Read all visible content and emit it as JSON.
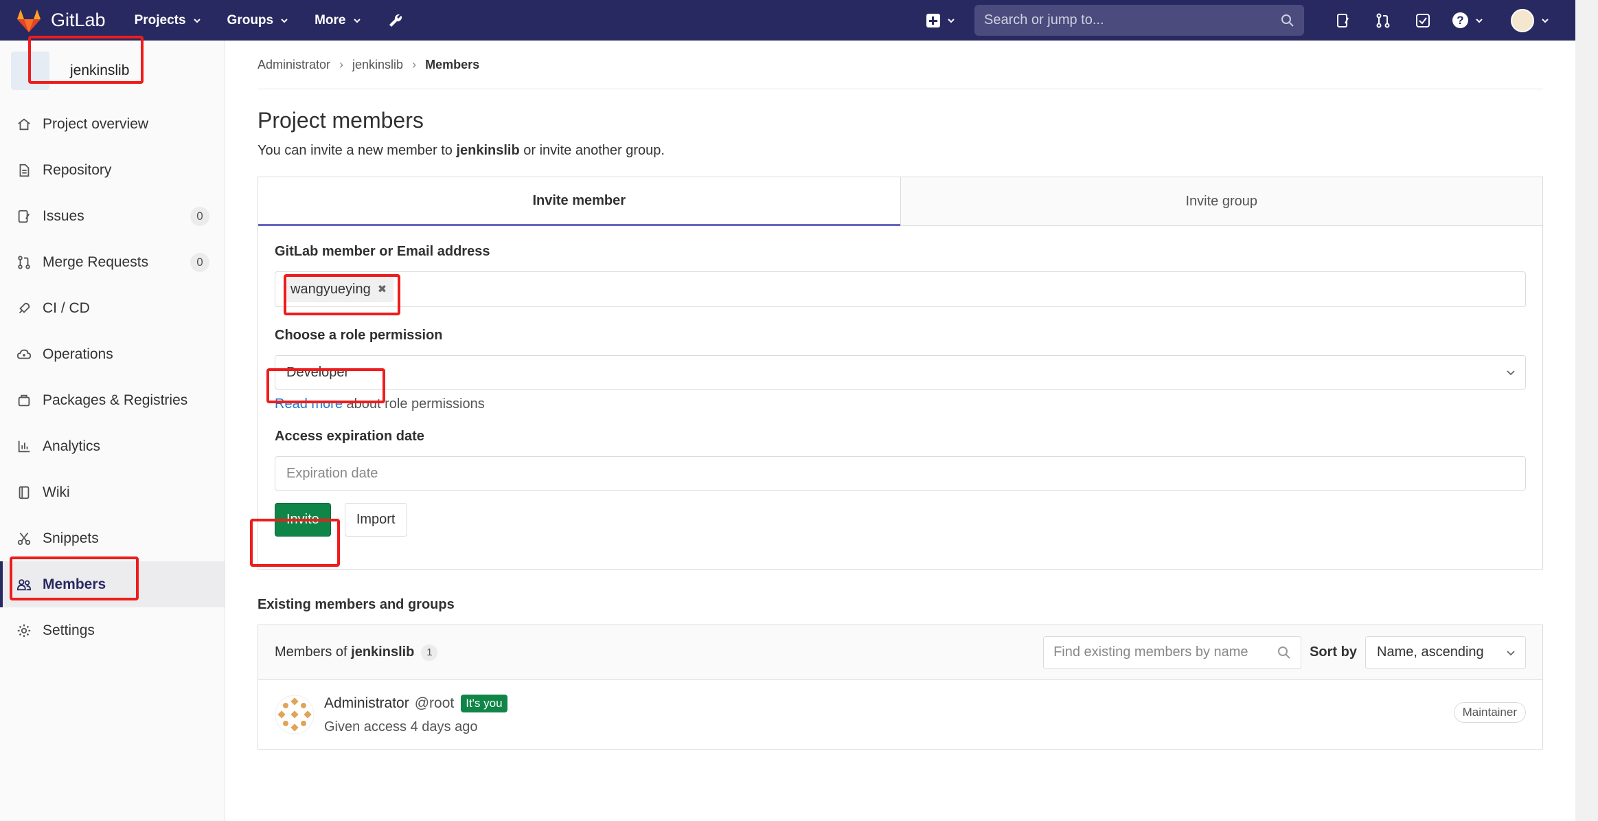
{
  "navbar": {
    "brand": "GitLab",
    "menu": [
      "Projects",
      "Groups",
      "More"
    ],
    "search_placeholder": "Search or jump to...",
    "icons": [
      "wrench-icon",
      "plus-icon",
      "search-icon",
      "issues-icon",
      "merge-request-icon",
      "todo-icon",
      "help-icon",
      "user-avatar"
    ],
    "color": "#292961"
  },
  "sidebar": {
    "project_name": "jenkinslib",
    "items": [
      {
        "label": "Project overview",
        "icon": "home-icon"
      },
      {
        "label": "Repository",
        "icon": "document-icon"
      },
      {
        "label": "Issues",
        "icon": "issues-icon",
        "count": "0"
      },
      {
        "label": "Merge Requests",
        "icon": "merge-request-icon",
        "count": "0"
      },
      {
        "label": "CI / CD",
        "icon": "rocket-icon"
      },
      {
        "label": "Operations",
        "icon": "cloud-gear-icon"
      },
      {
        "label": "Packages & Registries",
        "icon": "package-icon"
      },
      {
        "label": "Analytics",
        "icon": "chart-icon"
      },
      {
        "label": "Wiki",
        "icon": "book-icon"
      },
      {
        "label": "Snippets",
        "icon": "scissors-icon"
      },
      {
        "label": "Members",
        "icon": "users-icon",
        "active": true
      },
      {
        "label": "Settings",
        "icon": "gear-icon"
      }
    ]
  },
  "breadcrumb": [
    "Administrator",
    "jenkinslib",
    "Members"
  ],
  "page": {
    "title": "Project members",
    "intro_prefix": "You can invite a new member to ",
    "intro_project": "jenkinslib",
    "intro_suffix": " or invite another group."
  },
  "invite": {
    "tabs": [
      "Invite member",
      "Invite group"
    ],
    "member_label": "GitLab member or Email address",
    "token": "wangyueying",
    "role_label": "Choose a role permission",
    "role_value": "Developer",
    "help_link": "Read more",
    "help_text": " about role permissions",
    "expiration_label": "Access expiration date",
    "expiration_placeholder": "Expiration date",
    "invite_button": "Invite",
    "import_button": "Import"
  },
  "existing": {
    "title": "Existing members and groups",
    "members_of": "Members of ",
    "project": "jenkinslib",
    "count": "1",
    "filter_placeholder": "Find existing members by name",
    "sort_label": "Sort by",
    "sort_value": "Name, ascending",
    "members": [
      {
        "name": "Administrator",
        "handle": "@root",
        "badge": "It's you",
        "access": "Given access 4 days ago",
        "role": "Maintainer"
      }
    ]
  },
  "colors": {
    "accent": "#6666c4",
    "green": "#108548",
    "link": "#1f78d1",
    "annotation": "#ee1c1c"
  }
}
